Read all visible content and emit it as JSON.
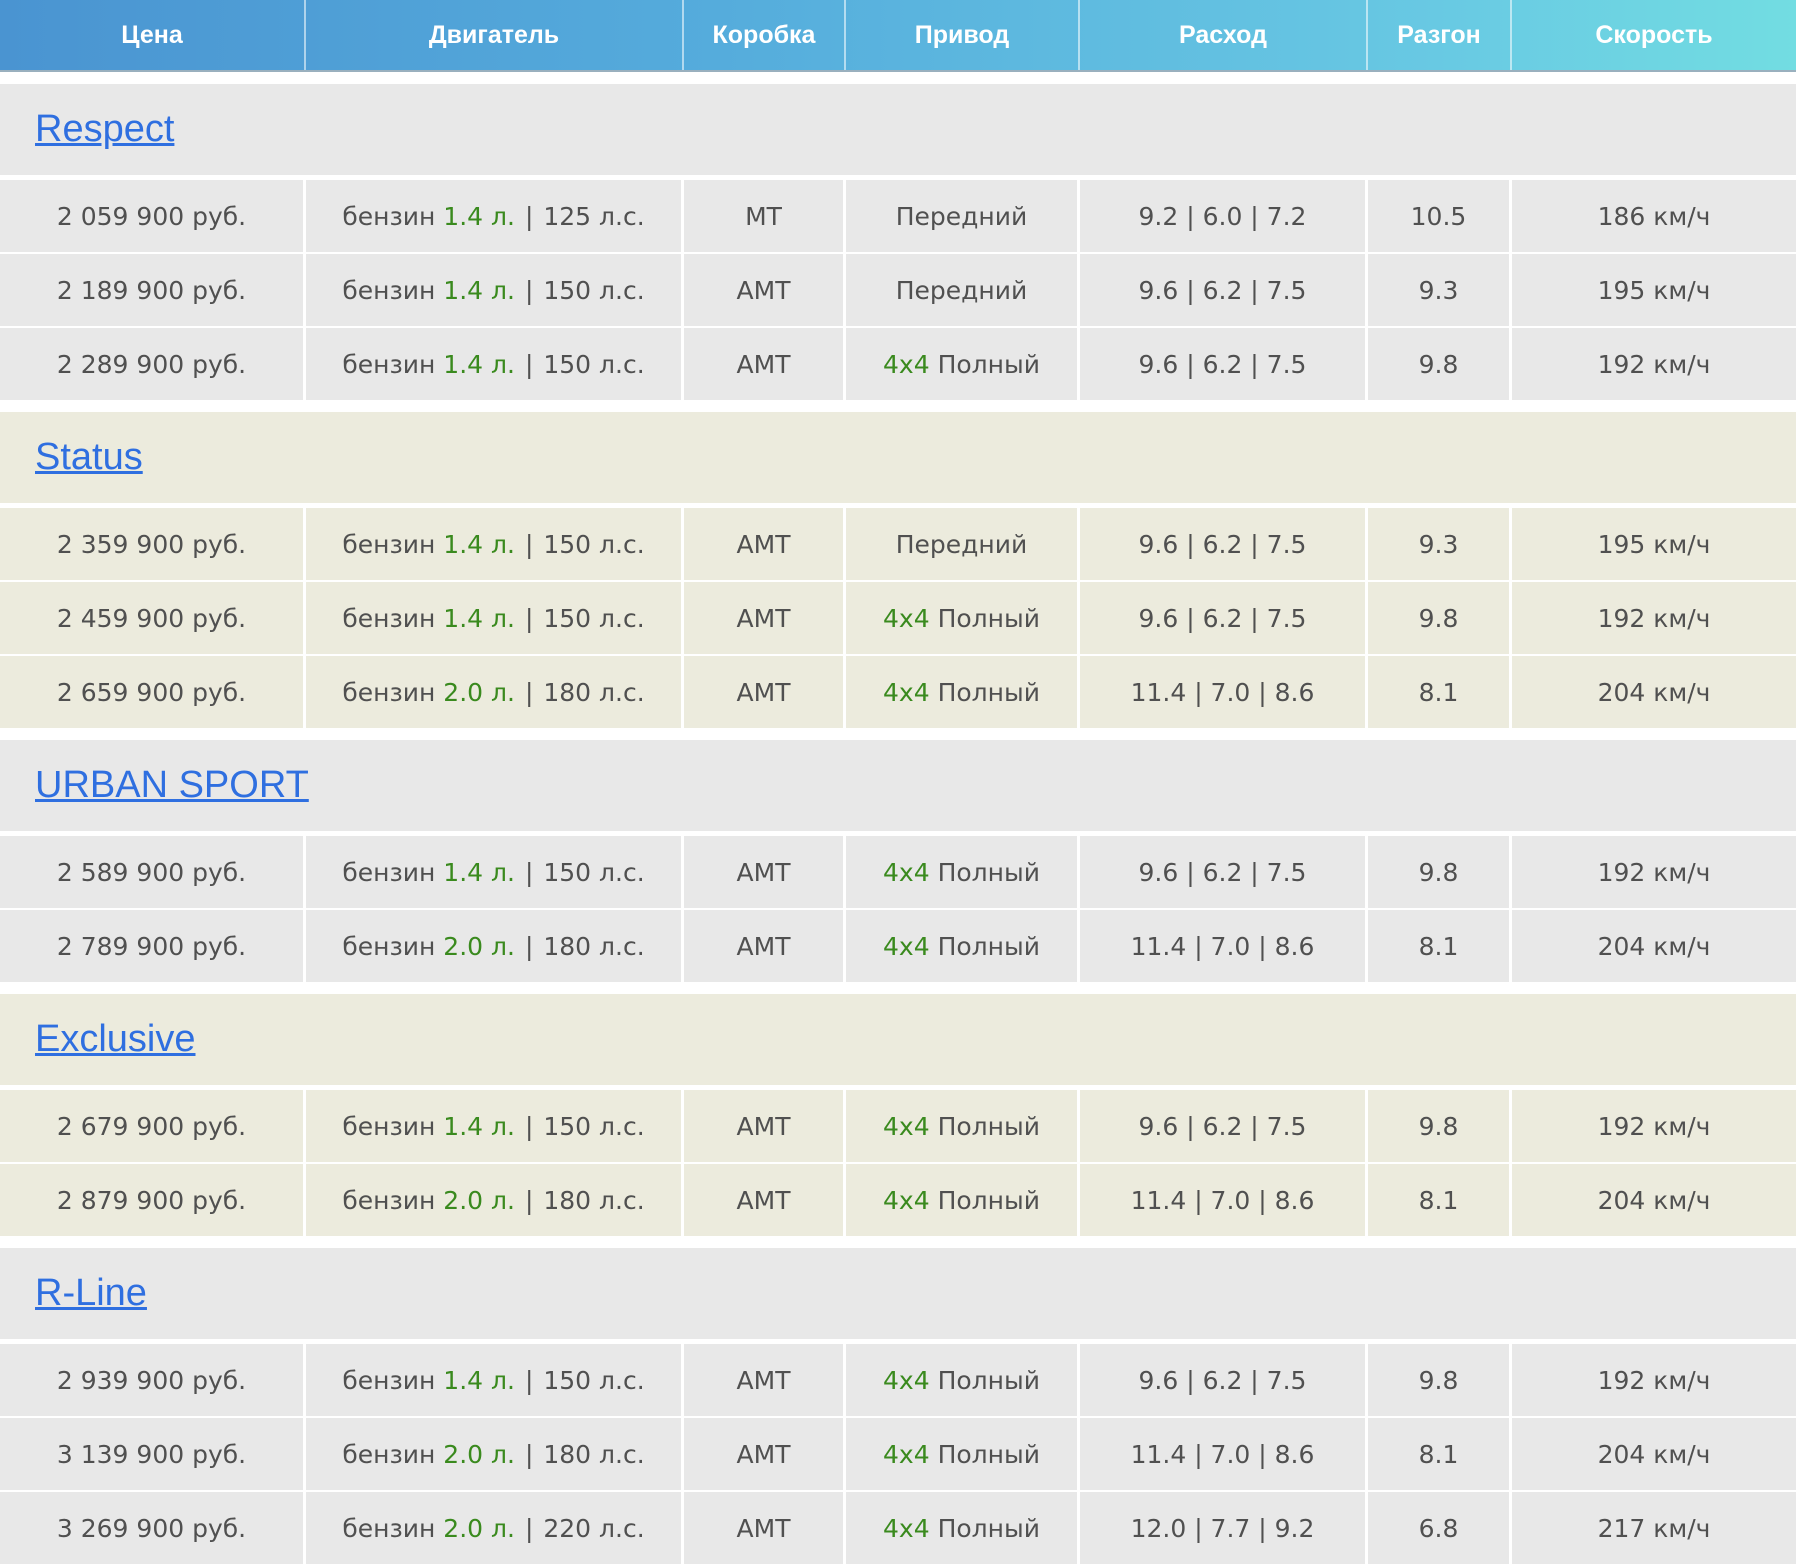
{
  "columns": [
    "Цена",
    "Двигатель",
    "Коробка",
    "Привод",
    "Расход",
    "Разгон",
    "Скорость"
  ],
  "groups": [
    {
      "name": "Respect",
      "tone": "grey",
      "rows": [
        {
          "price": "2 059 900 руб.",
          "fuel": "бензин",
          "volume": "1.4 л.",
          "power": "125 л.с.",
          "gearbox": "МТ",
          "drive_tag": "",
          "drive": "Передний",
          "consumption": "9.2 | 6.0 | 7.2",
          "accel": "10.5",
          "speed": "186 км/ч"
        },
        {
          "price": "2 189 900 руб.",
          "fuel": "бензин",
          "volume": "1.4 л.",
          "power": "150 л.с.",
          "gearbox": "АМТ",
          "drive_tag": "",
          "drive": "Передний",
          "consumption": "9.6 | 6.2 | 7.5",
          "accel": "9.3",
          "speed": "195 км/ч"
        },
        {
          "price": "2 289 900 руб.",
          "fuel": "бензин",
          "volume": "1.4 л.",
          "power": "150 л.с.",
          "gearbox": "АМТ",
          "drive_tag": "4x4",
          "drive": "Полный",
          "consumption": "9.6 | 6.2 | 7.5",
          "accel": "9.8",
          "speed": "192 км/ч"
        }
      ]
    },
    {
      "name": "Status",
      "tone": "beige",
      "rows": [
        {
          "price": "2 359 900 руб.",
          "fuel": "бензин",
          "volume": "1.4 л.",
          "power": "150 л.с.",
          "gearbox": "АМТ",
          "drive_tag": "",
          "drive": "Передний",
          "consumption": "9.6 | 6.2 | 7.5",
          "accel": "9.3",
          "speed": "195 км/ч"
        },
        {
          "price": "2 459 900 руб.",
          "fuel": "бензин",
          "volume": "1.4 л.",
          "power": "150 л.с.",
          "gearbox": "АМТ",
          "drive_tag": "4x4",
          "drive": "Полный",
          "consumption": "9.6 | 6.2 | 7.5",
          "accel": "9.8",
          "speed": "192 км/ч"
        },
        {
          "price": "2 659 900 руб.",
          "fuel": "бензин",
          "volume": "2.0 л.",
          "power": "180 л.с.",
          "gearbox": "АМТ",
          "drive_tag": "4x4",
          "drive": "Полный",
          "consumption": "11.4 | 7.0 | 8.6",
          "accel": "8.1",
          "speed": "204 км/ч"
        }
      ]
    },
    {
      "name": "URBAN SPORT",
      "tone": "grey",
      "rows": [
        {
          "price": "2 589 900 руб.",
          "fuel": "бензин",
          "volume": "1.4 л.",
          "power": "150 л.с.",
          "gearbox": "АМТ",
          "drive_tag": "4x4",
          "drive": "Полный",
          "consumption": "9.6 | 6.2 | 7.5",
          "accel": "9.8",
          "speed": "192 км/ч"
        },
        {
          "price": "2 789 900 руб.",
          "fuel": "бензин",
          "volume": "2.0 л.",
          "power": "180 л.с.",
          "gearbox": "АМТ",
          "drive_tag": "4x4",
          "drive": "Полный",
          "consumption": "11.4 | 7.0 | 8.6",
          "accel": "8.1",
          "speed": "204 км/ч"
        }
      ]
    },
    {
      "name": "Exclusive",
      "tone": "beige",
      "rows": [
        {
          "price": "2 679 900 руб.",
          "fuel": "бензин",
          "volume": "1.4 л.",
          "power": "150 л.с.",
          "gearbox": "АМТ",
          "drive_tag": "4x4",
          "drive": "Полный",
          "consumption": "9.6 | 6.2 | 7.5",
          "accel": "9.8",
          "speed": "192 км/ч"
        },
        {
          "price": "2 879 900 руб.",
          "fuel": "бензин",
          "volume": "2.0 л.",
          "power": "180 л.с.",
          "gearbox": "АМТ",
          "drive_tag": "4x4",
          "drive": "Полный",
          "consumption": "11.4 | 7.0 | 8.6",
          "accel": "8.1",
          "speed": "204 км/ч"
        }
      ]
    },
    {
      "name": "R-Line",
      "tone": "grey",
      "rows": [
        {
          "price": "2 939 900 руб.",
          "fuel": "бензин",
          "volume": "1.4 л.",
          "power": "150 л.с.",
          "gearbox": "АМТ",
          "drive_tag": "4x4",
          "drive": "Полный",
          "consumption": "9.6 | 6.2 | 7.5",
          "accel": "9.8",
          "speed": "192 км/ч"
        },
        {
          "price": "3 139 900 руб.",
          "fuel": "бензин",
          "volume": "2.0 л.",
          "power": "180 л.с.",
          "gearbox": "АМТ",
          "drive_tag": "4x4",
          "drive": "Полный",
          "consumption": "11.4 | 7.0 | 8.6",
          "accel": "8.1",
          "speed": "204 км/ч"
        },
        {
          "price": "3 269 900 руб.",
          "fuel": "бензин",
          "volume": "2.0 л.",
          "power": "220 л.с.",
          "gearbox": "АМТ",
          "drive_tag": "4x4",
          "drive": "Полный",
          "consumption": "12.0 | 7.7 | 9.2",
          "accel": "6.8",
          "speed": "217 км/ч"
        }
      ]
    }
  ],
  "colors": {
    "header_gradient": [
      "#4a94d1",
      "#72dde2"
    ],
    "link": "#2f6fe0",
    "accent_green": "#3a8a1e",
    "grey_group": "#e8e8e8",
    "beige_group": "#ecebdd"
  }
}
